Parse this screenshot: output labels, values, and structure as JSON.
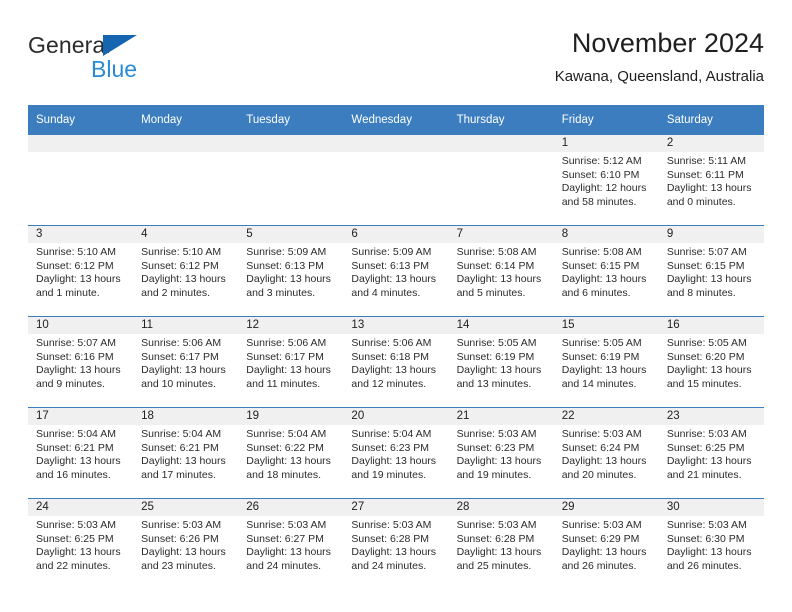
{
  "brand": {
    "name_top": "General",
    "name_bottom": "Blue",
    "accent_color": "#1565b0",
    "accent_light": "#2a8bd5"
  },
  "header": {
    "title": "November 2024",
    "subtitle": "Kawana, Queensland, Australia"
  },
  "theme": {
    "header_blue": "#3b7dbf",
    "daynum_bg": "#f0f0f0",
    "text": "#2b2b2b"
  },
  "weekdays": [
    "Sunday",
    "Monday",
    "Tuesday",
    "Wednesday",
    "Thursday",
    "Friday",
    "Saturday"
  ],
  "labels": {
    "sunrise": "Sunrise:",
    "sunset": "Sunset:",
    "daylight": "Daylight:"
  },
  "weeks": [
    [
      {
        "day": ""
      },
      {
        "day": ""
      },
      {
        "day": ""
      },
      {
        "day": ""
      },
      {
        "day": ""
      },
      {
        "day": "1",
        "sunrise": "Sunrise: 5:12 AM",
        "sunset": "Sunset: 6:10 PM",
        "daylight1": "Daylight: 12 hours",
        "daylight2": "and 58 minutes."
      },
      {
        "day": "2",
        "sunrise": "Sunrise: 5:11 AM",
        "sunset": "Sunset: 6:11 PM",
        "daylight1": "Daylight: 13 hours",
        "daylight2": "and 0 minutes."
      }
    ],
    [
      {
        "day": "3",
        "sunrise": "Sunrise: 5:10 AM",
        "sunset": "Sunset: 6:12 PM",
        "daylight1": "Daylight: 13 hours",
        "daylight2": "and 1 minute."
      },
      {
        "day": "4",
        "sunrise": "Sunrise: 5:10 AM",
        "sunset": "Sunset: 6:12 PM",
        "daylight1": "Daylight: 13 hours",
        "daylight2": "and 2 minutes."
      },
      {
        "day": "5",
        "sunrise": "Sunrise: 5:09 AM",
        "sunset": "Sunset: 6:13 PM",
        "daylight1": "Daylight: 13 hours",
        "daylight2": "and 3 minutes."
      },
      {
        "day": "6",
        "sunrise": "Sunrise: 5:09 AM",
        "sunset": "Sunset: 6:13 PM",
        "daylight1": "Daylight: 13 hours",
        "daylight2": "and 4 minutes."
      },
      {
        "day": "7",
        "sunrise": "Sunrise: 5:08 AM",
        "sunset": "Sunset: 6:14 PM",
        "daylight1": "Daylight: 13 hours",
        "daylight2": "and 5 minutes."
      },
      {
        "day": "8",
        "sunrise": "Sunrise: 5:08 AM",
        "sunset": "Sunset: 6:15 PM",
        "daylight1": "Daylight: 13 hours",
        "daylight2": "and 6 minutes."
      },
      {
        "day": "9",
        "sunrise": "Sunrise: 5:07 AM",
        "sunset": "Sunset: 6:15 PM",
        "daylight1": "Daylight: 13 hours",
        "daylight2": "and 8 minutes."
      }
    ],
    [
      {
        "day": "10",
        "sunrise": "Sunrise: 5:07 AM",
        "sunset": "Sunset: 6:16 PM",
        "daylight1": "Daylight: 13 hours",
        "daylight2": "and 9 minutes."
      },
      {
        "day": "11",
        "sunrise": "Sunrise: 5:06 AM",
        "sunset": "Sunset: 6:17 PM",
        "daylight1": "Daylight: 13 hours",
        "daylight2": "and 10 minutes."
      },
      {
        "day": "12",
        "sunrise": "Sunrise: 5:06 AM",
        "sunset": "Sunset: 6:17 PM",
        "daylight1": "Daylight: 13 hours",
        "daylight2": "and 11 minutes."
      },
      {
        "day": "13",
        "sunrise": "Sunrise: 5:06 AM",
        "sunset": "Sunset: 6:18 PM",
        "daylight1": "Daylight: 13 hours",
        "daylight2": "and 12 minutes."
      },
      {
        "day": "14",
        "sunrise": "Sunrise: 5:05 AM",
        "sunset": "Sunset: 6:19 PM",
        "daylight1": "Daylight: 13 hours",
        "daylight2": "and 13 minutes."
      },
      {
        "day": "15",
        "sunrise": "Sunrise: 5:05 AM",
        "sunset": "Sunset: 6:19 PM",
        "daylight1": "Daylight: 13 hours",
        "daylight2": "and 14 minutes."
      },
      {
        "day": "16",
        "sunrise": "Sunrise: 5:05 AM",
        "sunset": "Sunset: 6:20 PM",
        "daylight1": "Daylight: 13 hours",
        "daylight2": "and 15 minutes."
      }
    ],
    [
      {
        "day": "17",
        "sunrise": "Sunrise: 5:04 AM",
        "sunset": "Sunset: 6:21 PM",
        "daylight1": "Daylight: 13 hours",
        "daylight2": "and 16 minutes."
      },
      {
        "day": "18",
        "sunrise": "Sunrise: 5:04 AM",
        "sunset": "Sunset: 6:21 PM",
        "daylight1": "Daylight: 13 hours",
        "daylight2": "and 17 minutes."
      },
      {
        "day": "19",
        "sunrise": "Sunrise: 5:04 AM",
        "sunset": "Sunset: 6:22 PM",
        "daylight1": "Daylight: 13 hours",
        "daylight2": "and 18 minutes."
      },
      {
        "day": "20",
        "sunrise": "Sunrise: 5:04 AM",
        "sunset": "Sunset: 6:23 PM",
        "daylight1": "Daylight: 13 hours",
        "daylight2": "and 19 minutes."
      },
      {
        "day": "21",
        "sunrise": "Sunrise: 5:03 AM",
        "sunset": "Sunset: 6:23 PM",
        "daylight1": "Daylight: 13 hours",
        "daylight2": "and 19 minutes."
      },
      {
        "day": "22",
        "sunrise": "Sunrise: 5:03 AM",
        "sunset": "Sunset: 6:24 PM",
        "daylight1": "Daylight: 13 hours",
        "daylight2": "and 20 minutes."
      },
      {
        "day": "23",
        "sunrise": "Sunrise: 5:03 AM",
        "sunset": "Sunset: 6:25 PM",
        "daylight1": "Daylight: 13 hours",
        "daylight2": "and 21 minutes."
      }
    ],
    [
      {
        "day": "24",
        "sunrise": "Sunrise: 5:03 AM",
        "sunset": "Sunset: 6:25 PM",
        "daylight1": "Daylight: 13 hours",
        "daylight2": "and 22 minutes."
      },
      {
        "day": "25",
        "sunrise": "Sunrise: 5:03 AM",
        "sunset": "Sunset: 6:26 PM",
        "daylight1": "Daylight: 13 hours",
        "daylight2": "and 23 minutes."
      },
      {
        "day": "26",
        "sunrise": "Sunrise: 5:03 AM",
        "sunset": "Sunset: 6:27 PM",
        "daylight1": "Daylight: 13 hours",
        "daylight2": "and 24 minutes."
      },
      {
        "day": "27",
        "sunrise": "Sunrise: 5:03 AM",
        "sunset": "Sunset: 6:28 PM",
        "daylight1": "Daylight: 13 hours",
        "daylight2": "and 24 minutes."
      },
      {
        "day": "28",
        "sunrise": "Sunrise: 5:03 AM",
        "sunset": "Sunset: 6:28 PM",
        "daylight1": "Daylight: 13 hours",
        "daylight2": "and 25 minutes."
      },
      {
        "day": "29",
        "sunrise": "Sunrise: 5:03 AM",
        "sunset": "Sunset: 6:29 PM",
        "daylight1": "Daylight: 13 hours",
        "daylight2": "and 26 minutes."
      },
      {
        "day": "30",
        "sunrise": "Sunrise: 5:03 AM",
        "sunset": "Sunset: 6:30 PM",
        "daylight1": "Daylight: 13 hours",
        "daylight2": "and 26 minutes."
      }
    ]
  ]
}
